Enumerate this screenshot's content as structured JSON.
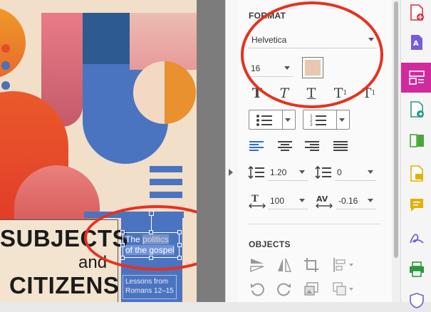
{
  "canvas": {
    "title_line1": "SUBJECTS",
    "title_line2": "and",
    "title_line3": "CITIZENS",
    "selected_text_1": "The ",
    "selected_text_hl1": "politics",
    "selected_text_2": "of the gospel",
    "sub_text_1": "Lessons from",
    "sub_text_2": "Romans 12–15"
  },
  "panel": {
    "format_title": "FORMAT",
    "font_family": "Helvetica",
    "font_size": "16",
    "font_color": "#e8c8b0",
    "line_spacing": "1.20",
    "para_spacing": "0",
    "horizontal_scale": "100",
    "char_spacing": "-0.16",
    "objects_title": "OBJECTS"
  },
  "colors": {
    "accent": "#d12a9c",
    "highlight": "#e8301f"
  },
  "toolbar": {
    "tools": [
      "create-pdf-icon",
      "export-pdf-icon",
      "edit-pdf-icon",
      "convert-icon",
      "organize-pages-icon",
      "comment-pdf-icon",
      "comment-icon",
      "fill-sign-icon",
      "print-production-icon",
      "protect-icon"
    ]
  }
}
